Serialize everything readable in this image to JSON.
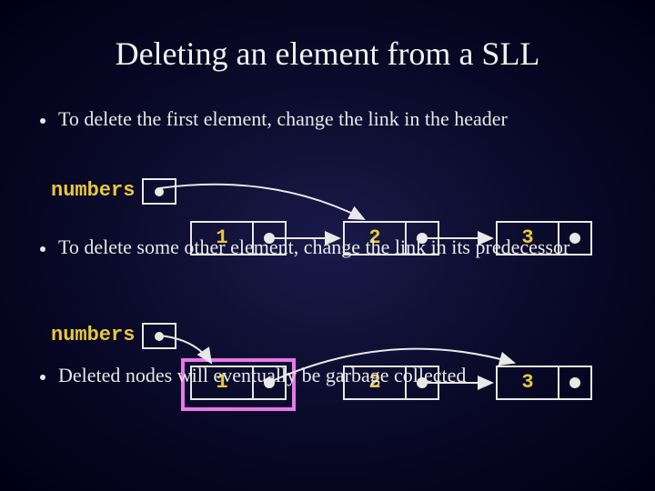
{
  "title": "Deleting an element from a SLL",
  "bullets": {
    "b1": "To delete the first element, change the link in the header",
    "b2": "To delete some other element, change the link in its predecessor",
    "b3": "Deleted nodes will eventually be garbage collected"
  },
  "labels": {
    "numbers": "numbers"
  },
  "diagram1": {
    "nodes": [
      "1",
      "2",
      "3"
    ]
  },
  "diagram2": {
    "nodes": [
      "1",
      "2",
      "3"
    ]
  }
}
